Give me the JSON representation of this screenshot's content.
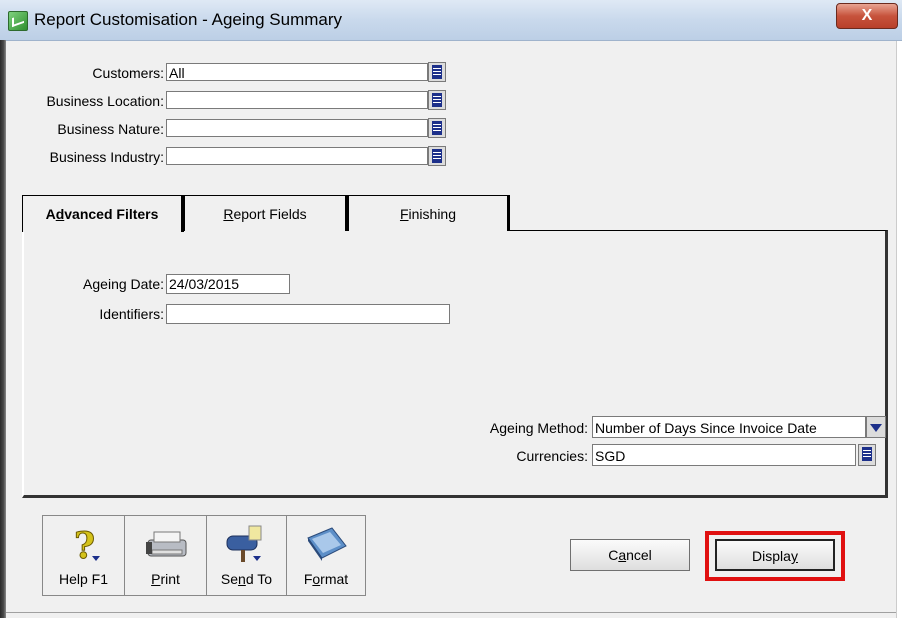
{
  "window": {
    "title": "Report Customisation - Ageing Summary",
    "close_label": "X"
  },
  "top_fields": [
    {
      "label": "Customers:",
      "value": "All"
    },
    {
      "label": "Business Location:",
      "value": ""
    },
    {
      "label": "Business Nature:",
      "value": ""
    },
    {
      "label": "Business Industry:",
      "value": ""
    }
  ],
  "tabs": [
    {
      "pre": "A",
      "u": "d",
      "post": "vanced Filters",
      "active": true
    },
    {
      "pre": "",
      "u": "R",
      "post": "eport Fields",
      "active": false
    },
    {
      "pre": "",
      "u": "F",
      "post": "inishing",
      "active": false
    }
  ],
  "advanced_filters": {
    "ageing_date_label": "Ageing Date:",
    "ageing_date_value": "24/03/2015",
    "identifiers_label": "Identifiers:",
    "identifiers_value": "",
    "ageing_method_label": "Ageing Method:",
    "ageing_method_value": "Number of Days Since Invoice Date",
    "currencies_label": "Currencies:",
    "currencies_value": "SGD"
  },
  "toolbar": {
    "help": {
      "pre": "Help F1",
      "u": "",
      "post": ""
    },
    "print": {
      "pre": "",
      "u": "P",
      "post": "rint"
    },
    "send_to": {
      "pre": "Se",
      "u": "n",
      "post": "d To"
    },
    "format": {
      "pre": "F",
      "u": "o",
      "post": "rmat"
    }
  },
  "buttons": {
    "cancel": {
      "pre": "C",
      "u": "a",
      "post": "ncel"
    },
    "display": {
      "pre": "Displa",
      "u": "y",
      "post": ""
    }
  },
  "colors": {
    "highlight": "#e01010",
    "dropdown_icon": "#1c2f8a"
  }
}
